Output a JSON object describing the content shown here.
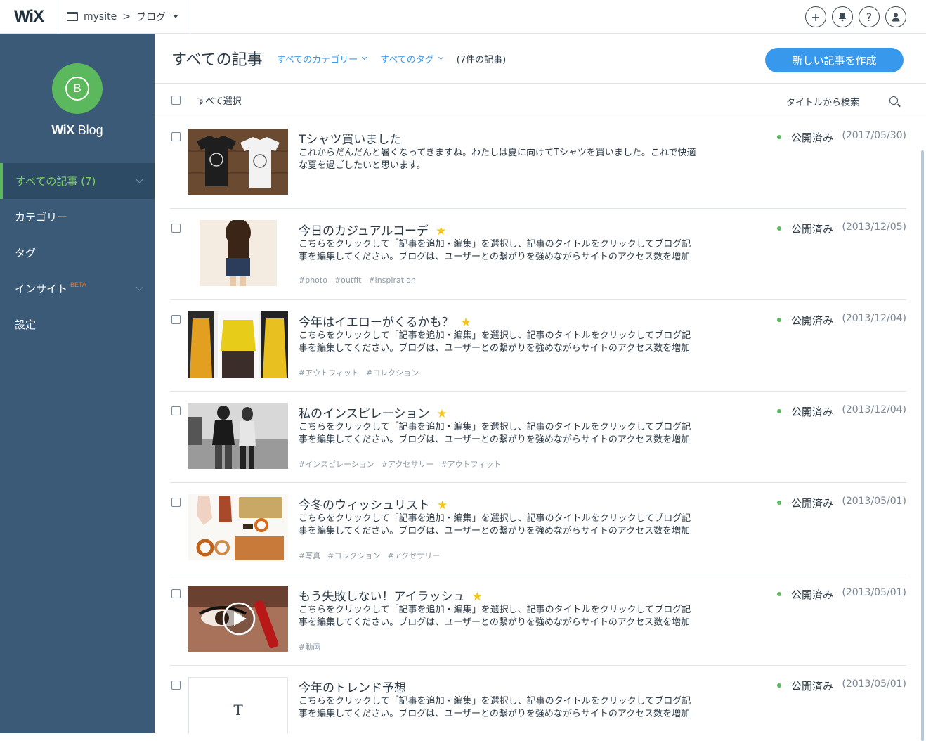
{
  "topbar": {
    "logo": "WiX",
    "site": "mysite",
    "separator": ">",
    "section": "ブログ"
  },
  "sidebar": {
    "logo_letter": "B",
    "brand_bold": "WiX",
    "brand_rest": " Blog",
    "items": [
      {
        "label": "すべての記事 (7)"
      },
      {
        "label": "カテゴリー"
      },
      {
        "label": "タグ"
      },
      {
        "label": "インサイト",
        "badge": "BETA"
      },
      {
        "label": "設定"
      }
    ]
  },
  "header": {
    "title": "すべての記事",
    "filter_category": "すべてのカテゴリー",
    "filter_tag": "すべてのタグ",
    "count": "(7件の記事)",
    "new_button": "新しい記事を作成"
  },
  "subbar": {
    "select_all": "すべて選択",
    "search_placeholder": "タイトルから検索"
  },
  "posts": [
    {
      "title": "Tシャツ買いました",
      "featured": false,
      "excerpt": "これからだんだんと暑くなってきますね。わたしは夏に向けてTシャツを買いました。これで快適な夏を過ごしたいと思います。",
      "tags": [],
      "status": "公開済み",
      "date": "(2017/05/30)"
    },
    {
      "title": "今日のカジュアルコーデ",
      "featured": true,
      "excerpt": "こちらをクリックして「記事を追加・編集」を選択し、記事のタイトルをクリックしてブログ記事を編集してください。ブログは、ユーザーとの繋がりを強めながらサイトのアクセス数を増加できる便利",
      "tags": [
        "#photo",
        "#outfit",
        "#inspiration"
      ],
      "status": "公開済み",
      "date": "(2013/12/05)"
    },
    {
      "title": "今年はイエローがくるかも？",
      "featured": true,
      "excerpt": "こちらをクリックして「記事を追加・編集」を選択し、記事のタイトルをクリックしてブログ記事を編集してください。ブログは、ユーザーとの繋がりを強めながらサイトのアクセス数を増加できる便利",
      "tags": [
        "#アウトフィット",
        "#コレクション"
      ],
      "status": "公開済み",
      "date": "(2013/12/04)"
    },
    {
      "title": "私のインスピレーション",
      "featured": true,
      "excerpt": "こちらをクリックして「記事を追加・編集」を選択し、記事のタイトルをクリックしてブログ記事を編集してください。ブログは、ユーザーとの繋がりを強めながらサイトのアクセス数を増加できる便利",
      "tags": [
        "#インスピレーション",
        "#アクセサリー",
        "#アウトフィット"
      ],
      "status": "公開済み",
      "date": "(2013/12/04)"
    },
    {
      "title": "今冬のウィッシュリスト",
      "featured": true,
      "excerpt": "こちらをクリックして「記事を追加・編集」を選択し、記事のタイトルをクリックしてブログ記事を編集してください。ブログは、ユーザーとの繋がりを強めながらサイトのアクセス数を増加できる便利",
      "tags": [
        "#写真",
        "#コレクション",
        "#アクセサリー"
      ],
      "status": "公開済み",
      "date": "(2013/05/01)"
    },
    {
      "title": "もう失敗しない！アイラッシュ",
      "featured": true,
      "excerpt": "こちらをクリックして「記事を追加・編集」を選択し、記事のタイトルをクリックしてブログ記事を編集してください。ブログは、ユーザーとの繋がりを強めながらサイトのアクセス数を増加できる便利",
      "tags": [
        "#動画"
      ],
      "status": "公開済み",
      "date": "(2013/05/01)"
    },
    {
      "title": "今年のトレンド予想",
      "featured": false,
      "excerpt": "こちらをクリックして「記事を追加・編集」を選択し、記事のタイトルをクリックしてブログ記事を編集してください。ブログは、ユーザーとの繋がりを強めながらサイトのアクセス数を増加できる便利",
      "tags": [],
      "status": "公開済み",
      "date": "(2013/05/01)",
      "placeholder_letter": "T"
    }
  ],
  "icons": {
    "add": "plus-icon",
    "notifications": "bell-icon",
    "help": "question-icon",
    "account": "user-icon",
    "search": "search-icon",
    "star": "star-icon"
  },
  "colors": {
    "sidebar": "#3b5a77",
    "accent": "#3899ec",
    "active": "#7ed35a",
    "status_dot": "#5cb85c",
    "star": "#f5c518"
  }
}
